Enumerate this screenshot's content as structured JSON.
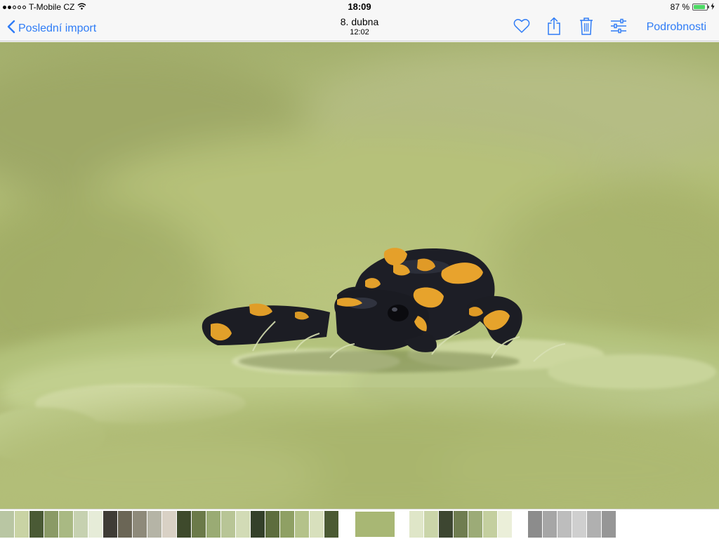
{
  "status_bar": {
    "carrier": "T-Mobile CZ",
    "signal_bars_filled": 2,
    "signal_bars_total": 5,
    "time": "18:09",
    "battery_percent": "87 %",
    "battery_level": 0.87
  },
  "nav": {
    "back_label": "Poslední import",
    "title_date": "8. dubna",
    "title_time": "12:02",
    "details_label": "Podrobnosti"
  },
  "icons": {
    "back": "chevron-left-icon",
    "favorite": "heart-icon",
    "share": "share-icon",
    "delete": "trash-icon",
    "edit": "sliders-icon",
    "wifi": "wifi-icon",
    "battery": "battery-icon",
    "charging": "bolt-icon"
  },
  "colors": {
    "accent": "#2f7cf6",
    "bar_background": "#f7f7f7",
    "battery_fill": "#4cd964"
  },
  "photo": {
    "description_name": "salamander-on-moss"
  },
  "thumbnails": [
    {
      "tone": "#b9c6a3"
    },
    {
      "tone": "#c9d3a4"
    },
    {
      "tone": "#4a5a35"
    },
    {
      "tone": "#8a9a66"
    },
    {
      "tone": "#a9b983"
    },
    {
      "tone": "#c6d1b0"
    },
    {
      "tone": "#e6ecd8"
    },
    {
      "tone": "#3f3c36"
    },
    {
      "tone": "#6b6656"
    },
    {
      "tone": "#8e8a7a"
    },
    {
      "tone": "#b5b4a6"
    },
    {
      "tone": "#d9d1c5"
    },
    {
      "tone": "#3e4a2c"
    },
    {
      "tone": "#6b7a49"
    },
    {
      "tone": "#9aab74"
    },
    {
      "tone": "#b8c596"
    },
    {
      "tone": "#d2dbb6"
    },
    {
      "tone": "#34402a"
    },
    {
      "tone": "#5d6d3e"
    },
    {
      "tone": "#8fa064"
    },
    {
      "tone": "#b4c28a"
    },
    {
      "tone": "#d8e0bd"
    },
    {
      "tone": "#4b5a33"
    },
    {
      "tone": "#a8b774"
    },
    {
      "tone": "#dfe6c8"
    },
    {
      "tone": "#cad5a9"
    },
    {
      "tone": "#3d4631"
    },
    {
      "tone": "#6f7d50"
    },
    {
      "tone": "#9cab77"
    },
    {
      "tone": "#c4cf9f"
    },
    {
      "tone": "#ebefd9"
    },
    {
      "tone": "#8c8c8c"
    },
    {
      "tone": "#a6a6a6"
    },
    {
      "tone": "#bdbdbd"
    },
    {
      "tone": "#cfcfcf"
    },
    {
      "tone": "#b0b0b0"
    },
    {
      "tone": "#969696"
    }
  ]
}
